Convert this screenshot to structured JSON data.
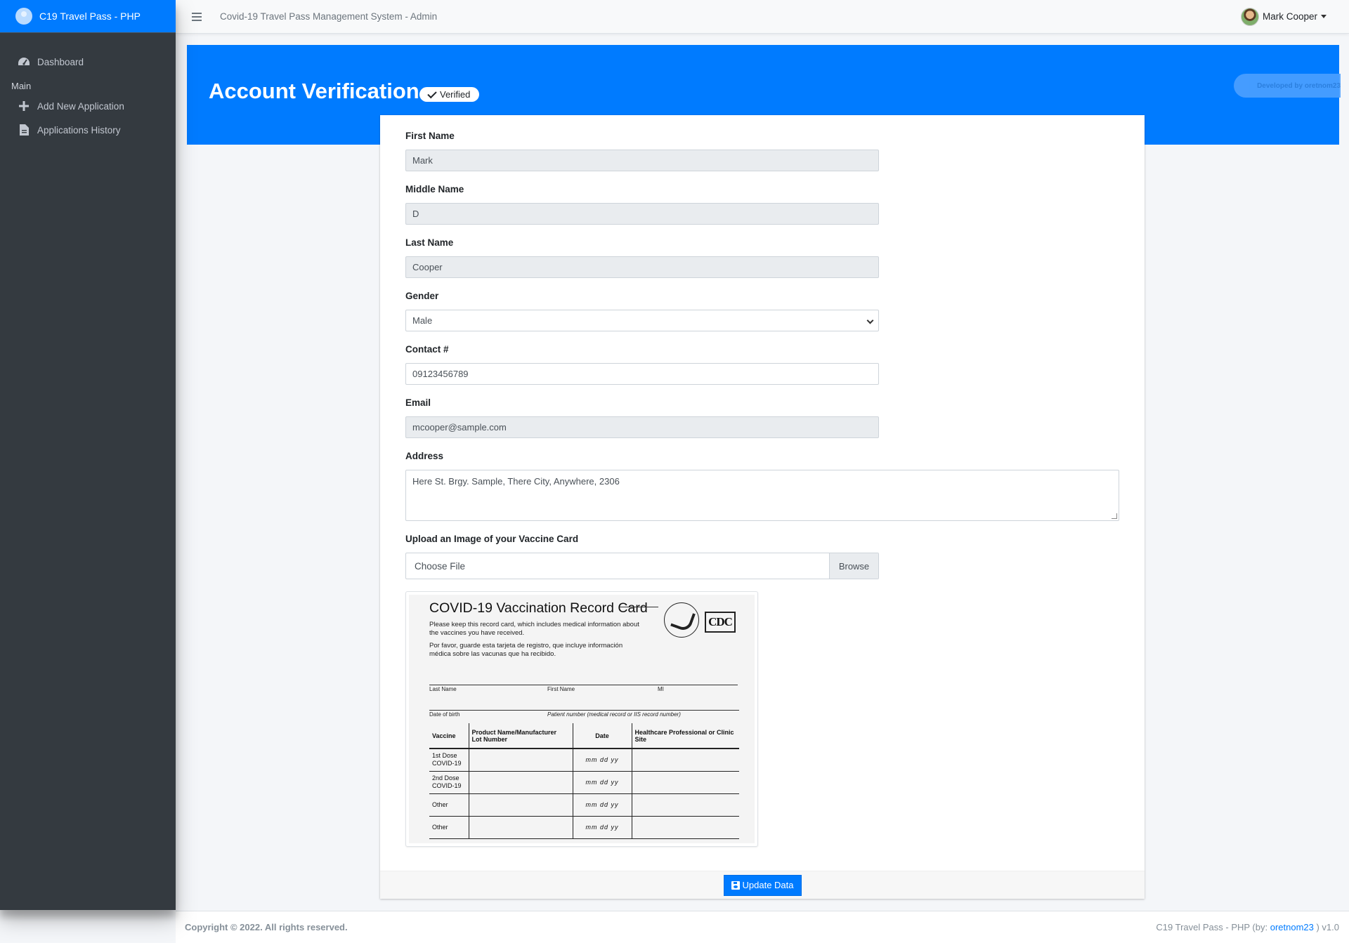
{
  "brand": {
    "name": "C19 Travel Pass - PHP"
  },
  "sidebar": {
    "items": [
      {
        "label": "Dashboard",
        "icon": "dashboard-icon"
      },
      {
        "label": "Add New Application",
        "icon": "plus-icon"
      },
      {
        "label": "Applications History",
        "icon": "file-icon"
      }
    ],
    "header_main": "Main"
  },
  "topbar": {
    "system_title": "Covid-19 Travel Pass Management System - Admin",
    "user_name": "Mark Cooper"
  },
  "banner": {
    "title": "Account Verification",
    "badge": "Verified",
    "developer": "Developed by oretnom23"
  },
  "form": {
    "first_name": {
      "label": "First Name",
      "value": "Mark"
    },
    "middle_name": {
      "label": "Middle Name",
      "value": "D"
    },
    "last_name": {
      "label": "Last Name",
      "value": "Cooper"
    },
    "gender": {
      "label": "Gender",
      "value": "Male"
    },
    "contact": {
      "label": "Contact #",
      "value": "09123456789"
    },
    "email": {
      "label": "Email",
      "value": "mcooper@sample.com"
    },
    "address": {
      "label": "Address",
      "value": "Here St. Brgy. Sample, There City, Anywhere, 2306"
    },
    "upload": {
      "label": "Upload an Image of your Vaccine Card",
      "file_text": "Choose File",
      "browse": "Browse"
    },
    "submit": "Update Data"
  },
  "vaccine_card": {
    "title": "COVID-19 Vaccination Record Card",
    "para_en": "Please keep this record card, which includes medical information about the vaccines you have received.",
    "para_es": "Por favor, guarde esta tarjeta de registro, que incluye información médica sobre las vacunas que ha recibido.",
    "cdc": "CDC",
    "last_name": "Last Name",
    "first_name": "First Name",
    "mi": "MI",
    "dob": "Date of birth",
    "patient_number": "Patient number (medical record or IIS record number)",
    "col_vaccine": "Vaccine",
    "col_product": "Product Name/Manufacturer",
    "col_lot": "Lot Number",
    "col_date": "Date",
    "col_site": "Healthcare Professional or Clinic Site",
    "date_hint": "mm dd yy",
    "rows": [
      "1st Dose COVID-19",
      "2nd Dose COVID-19",
      "Other",
      "Other"
    ]
  },
  "footer": {
    "copyright": "Copyright © 2022. All rights reserved.",
    "app_prefix": "C19 Travel Pass - PHP (by: ",
    "author": "oretnom23",
    "app_suffix": " ) v1.0"
  }
}
